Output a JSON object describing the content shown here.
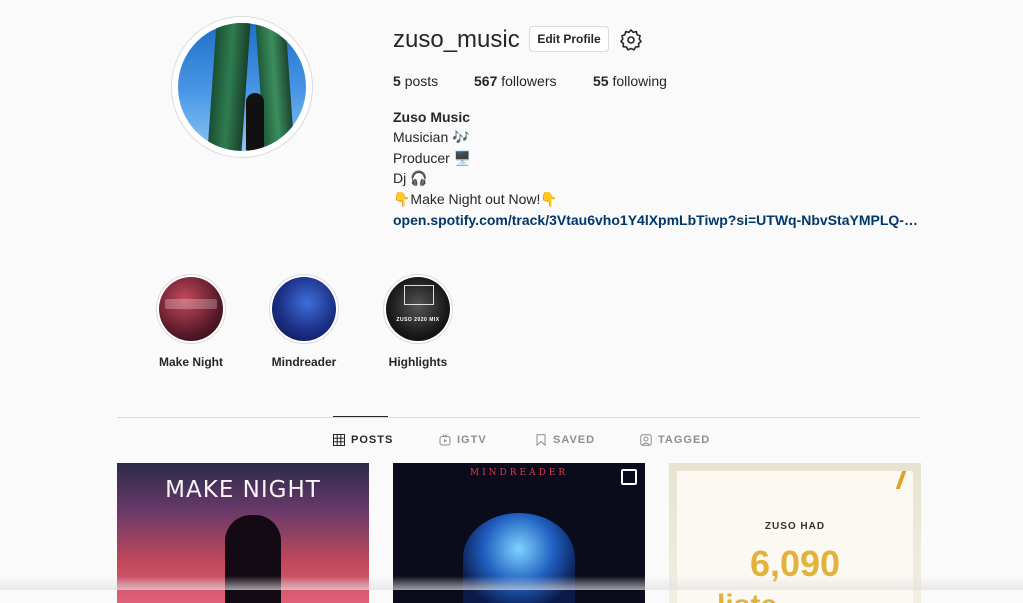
{
  "profile": {
    "username": "zuso_music",
    "edit_profile_label": "Edit Profile",
    "settings_icon": "gear-icon"
  },
  "stats": {
    "posts_count": "5",
    "posts_label": "posts",
    "followers_count": "567",
    "followers_label": "followers",
    "following_count": "55",
    "following_label": "following"
  },
  "bio": {
    "name": "Zuso Music",
    "line1": "Musician 🎶",
    "line2": "Producer 🖥️",
    "line3": "Dj 🎧",
    "line4": "👇Make Night out Now!👇",
    "link": "open.spotify.com/track/3Vtau6vho1Y4lXpmLbTiwp?si=UTWq-NbvStaYMPLQ-X..."
  },
  "highlights": [
    {
      "label": "Make Night"
    },
    {
      "label": "Mindreader"
    },
    {
      "label": "Highlights",
      "cover_text": "ZUSO 2020 MIX"
    }
  ],
  "tabs": [
    {
      "label": "POSTS",
      "icon": "grid-icon",
      "active": true
    },
    {
      "label": "IGTV",
      "icon": "igtv-icon",
      "active": false
    },
    {
      "label": "SAVED",
      "icon": "bookmark-icon",
      "active": false
    },
    {
      "label": "TAGGED",
      "icon": "tagged-icon",
      "active": false
    }
  ],
  "posts": [
    {
      "title": "MAKE NIGHT"
    },
    {
      "title": "MINDREADER",
      "multi_icon": "carousel-icon"
    },
    {
      "small": "ZUSO HAD",
      "big": "6,090",
      "cut": "liste"
    }
  ],
  "colors": {
    "background": "#fafafa",
    "link": "#00376b",
    "text": "#262626",
    "muted": "#8e8e8e",
    "accent_gold": "#e3b23c"
  }
}
